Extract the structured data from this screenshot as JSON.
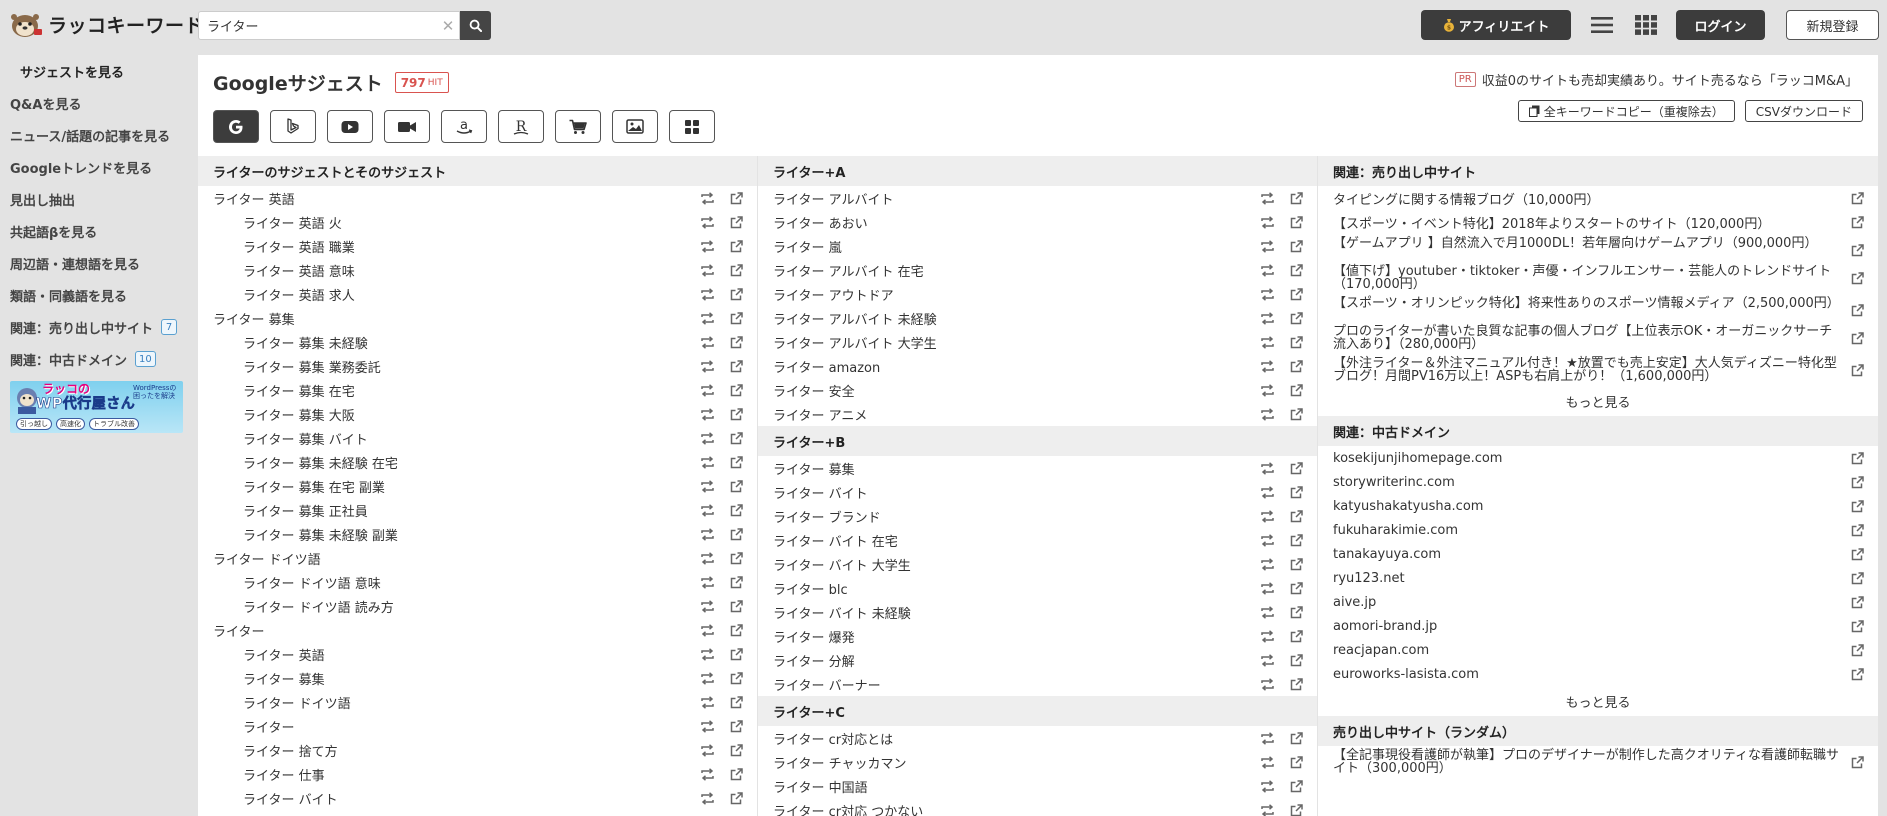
{
  "header": {
    "logo_text": "ラッコキーワード",
    "search_value": "ライター",
    "affiliate_label": "アフィリエイト",
    "login_label": "ログイン",
    "register_label": "新規登録"
  },
  "sidebar": {
    "items": [
      {
        "label": "サジェストを見る"
      },
      {
        "label": "Q&Aを見る"
      },
      {
        "label": "ニュース/話題の記事を見る"
      },
      {
        "label": "Googleトレンドを見る"
      },
      {
        "label": "見出し抽出"
      },
      {
        "label": "共起語βを見る"
      },
      {
        "label": "周辺語・連想語を見る"
      },
      {
        "label": "類語・同義語を見る"
      },
      {
        "label": "関連：売り出し中サイト",
        "badge": "7"
      },
      {
        "label": "関連：中古ドメイン",
        "badge": "10"
      }
    ],
    "banner": {
      "title_line1": "ラッコの",
      "title_line2": "WP代行屋さん",
      "tags": [
        "引っ越し",
        "高速化",
        "トラブル改善"
      ],
      "side_text": "WordPressの困ったを解決"
    }
  },
  "main": {
    "title": "Googleサジェスト",
    "hit_count": "797",
    "hit_label": "HIT",
    "pr_tag": "PR",
    "pr_text": "収益0のサイトも売却実績あり。サイト売るなら「ラッコM&A」",
    "copy_all_label": "全キーワードコピー（重複除去）",
    "csv_label": "CSVダウンロード",
    "engines": [
      "google-icon",
      "bing-icon",
      "youtube-icon",
      "video-icon",
      "amazon-icon",
      "rakuten-icon",
      "shopping-cart-icon",
      "image-icon",
      "apps-icon"
    ]
  },
  "col1": {
    "heading": "ライターのサジェストとそのサジェスト",
    "rows": [
      {
        "text": "ライター 英語",
        "sub": false
      },
      {
        "text": "ライター 英語 火",
        "sub": true
      },
      {
        "text": "ライター 英語 職業",
        "sub": true
      },
      {
        "text": "ライター 英語 意味",
        "sub": true
      },
      {
        "text": "ライター 英語 求人",
        "sub": true
      },
      {
        "text": "ライター 募集",
        "sub": false
      },
      {
        "text": "ライター 募集 未経験",
        "sub": true
      },
      {
        "text": "ライター 募集 業務委託",
        "sub": true
      },
      {
        "text": "ライター 募集 在宅",
        "sub": true
      },
      {
        "text": "ライター 募集 大阪",
        "sub": true
      },
      {
        "text": "ライター 募集 バイト",
        "sub": true
      },
      {
        "text": "ライター 募集 未経験 在宅",
        "sub": true
      },
      {
        "text": "ライター 募集 在宅 副業",
        "sub": true
      },
      {
        "text": "ライター 募集 正社員",
        "sub": true
      },
      {
        "text": "ライター 募集 未経験 副業",
        "sub": true
      },
      {
        "text": "ライター ドイツ語",
        "sub": false
      },
      {
        "text": "ライター ドイツ語 意味",
        "sub": true
      },
      {
        "text": "ライター ドイツ語 読み方",
        "sub": true
      },
      {
        "text": "ライター",
        "sub": false
      },
      {
        "text": "ライター 英語",
        "sub": true
      },
      {
        "text": "ライター 募集",
        "sub": true
      },
      {
        "text": "ライター ドイツ語",
        "sub": true
      },
      {
        "text": "ライター",
        "sub": true
      },
      {
        "text": "ライター 捨て方",
        "sub": true
      },
      {
        "text": "ライター 仕事",
        "sub": true
      },
      {
        "text": "ライター バイト",
        "sub": true
      }
    ]
  },
  "col2": {
    "sections": [
      {
        "heading": "ライター+A",
        "rows": [
          "ライター アルバイト",
          "ライター あおい",
          "ライター 嵐",
          "ライター アルバイト 在宅",
          "ライター アウトドア",
          "ライター アルバイト 未経験",
          "ライター アルバイト 大学生",
          "ライター amazon",
          "ライター 安全",
          "ライター アニメ"
        ]
      },
      {
        "heading": "ライター+B",
        "rows": [
          "ライター 募集",
          "ライター バイト",
          "ライター ブランド",
          "ライター バイト 在宅",
          "ライター バイト 大学生",
          "ライター blc",
          "ライター バイト 未経験",
          "ライター 爆発",
          "ライター 分解",
          "ライター バーナー"
        ]
      },
      {
        "heading": "ライター+C",
        "rows": [
          "ライター cr対応とは",
          "ライター チャッカマン",
          "ライター 中国語",
          "ライター cr対応 つかない"
        ]
      }
    ]
  },
  "col3": {
    "sites_heading": "関連：売り出し中サイト",
    "sites": [
      "タイピングに関する情報ブログ（10,000円）",
      "【スポーツ・イベント特化】2018年よりスタートのサイト（120,000円）",
      "【ゲームアプリ 】自然流入で月1000DL！若年層向けゲームアプリ（900,000円）",
      "【値下げ】youtuber・tiktoker・声優・インフルエンサー・芸能人のトレンドサイト（170,000円）",
      "【スポーツ・オリンピック特化】将来性ありのスポーツ情報メディア（2,500,000円）",
      "プロのライターが書いた良質な記事の個人ブログ【上位表示OK・オーガニックサーチ流入あり】（280,000円）",
      "【外注ライター＆外注マニュアル付き！★放置でも売上安定】大人気ディズニー特化型ブログ！月間PV16万以上！ASPも右肩上がり！（1,600,000円）"
    ],
    "more_label": "もっと見る",
    "domains_heading": "関連：中古ドメイン",
    "domains": [
      "kosekijunjihomepage.com",
      "storywriterinc.com",
      "katyushakatyusha.com",
      "fukuharakimie.com",
      "tanakayuya.com",
      "ryu123.net",
      "aive.jp",
      "aomori-brand.jp",
      "reacjapan.com",
      "euroworks-lasista.com"
    ],
    "more_label2": "もっと見る",
    "random_heading": "売り出し中サイト（ランダム）",
    "random": [
      "【全記事現役看護師が執筆】プロのデザイナーが制作した高クオリティな看護師転職サイト（300,000円）"
    ]
  }
}
